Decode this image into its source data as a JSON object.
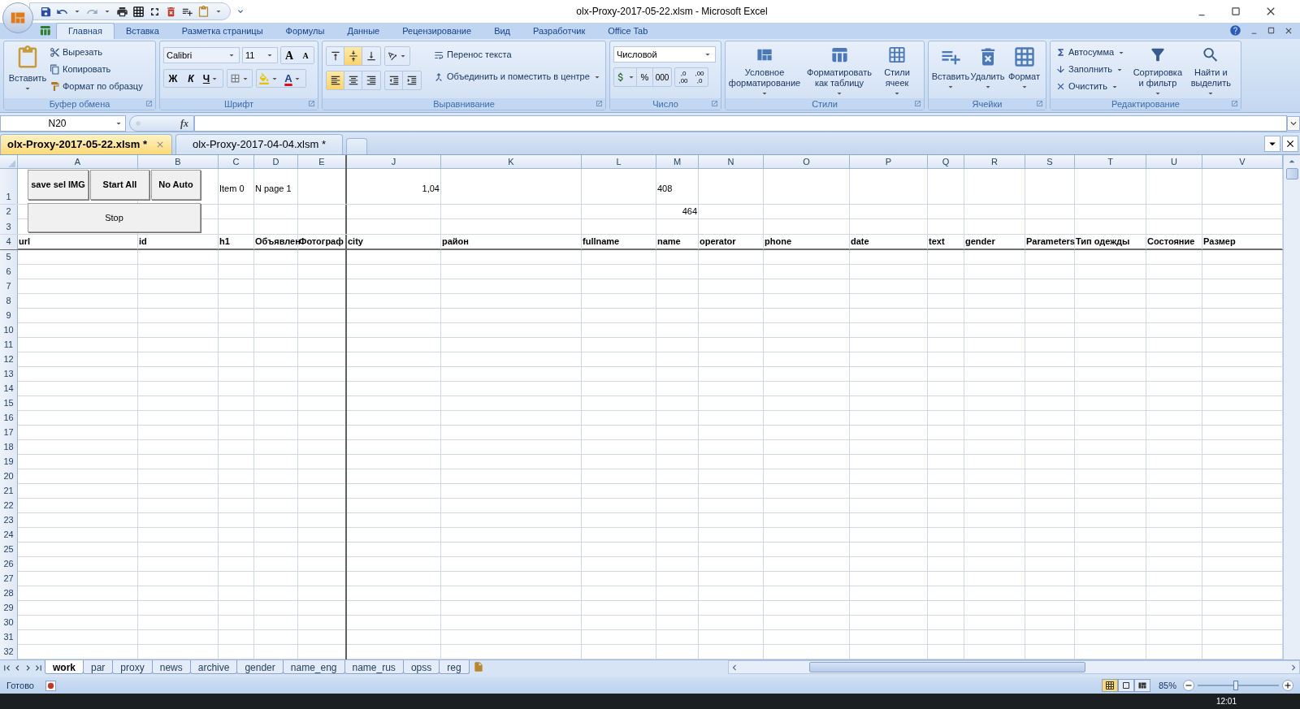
{
  "window": {
    "title": "olx-Proxy-2017-05-22.xlsm - Microsoft Excel"
  },
  "ribbon_tabs": [
    {
      "label": "Главная",
      "selected": true
    },
    {
      "label": "Вставка",
      "selected": false
    },
    {
      "label": "Разметка страницы",
      "selected": false
    },
    {
      "label": "Формулы",
      "selected": false
    },
    {
      "label": "Данные",
      "selected": false
    },
    {
      "label": "Рецензирование",
      "selected": false
    },
    {
      "label": "Вид",
      "selected": false
    },
    {
      "label": "Разработчик",
      "selected": false
    },
    {
      "label": "Office Tab",
      "selected": false
    }
  ],
  "clipboard": {
    "label": "Буфер обмена",
    "paste": "Вставить",
    "cut": "Вырезать",
    "copy": "Копировать",
    "format_painter": "Формат по образцу"
  },
  "font": {
    "label": "Шрифт",
    "name": "Calibri",
    "size": "11",
    "grow": "A",
    "shrink": "A",
    "bold": "Ж",
    "italic": "К",
    "underline": "Ч",
    "font_color": "A"
  },
  "alignment": {
    "label": "Выравнивание",
    "vertical": [
      {
        "selected": false
      },
      {
        "selected": true
      },
      {
        "selected": false
      }
    ],
    "horizontal": [
      {
        "selected": true
      },
      {
        "selected": false
      },
      {
        "selected": false
      }
    ],
    "wrap": "Перенос текста",
    "merge": "Объединить и поместить в центре"
  },
  "number": {
    "label": "Число",
    "format": "Числовой",
    "percent": "%",
    "thousands": "000",
    "decimals": [
      {
        "top": ",0",
        "bottom": ",00"
      },
      {
        "top": ",00",
        "bottom": ",0"
      }
    ]
  },
  "styles": {
    "label": "Стили",
    "buttons": [
      "Условное форматирование",
      "Форматировать как таблицу",
      "Стили ячеек"
    ]
  },
  "cells_group": {
    "label": "Ячейки",
    "buttons": [
      "Вставить",
      "Удалить",
      "Формат"
    ]
  },
  "editing": {
    "label": "Редактирование",
    "small": [
      "Автосумма",
      "Заполнить",
      "Очистить"
    ],
    "large": [
      "Сортировка и фильтр",
      "Найти и выделить"
    ]
  },
  "formula_bar": {
    "name_box": "N20",
    "fx": "fx"
  },
  "doc_tabs": [
    {
      "label": "olx-Proxy-2017-05-22.xlsm *",
      "selected": true
    },
    {
      "label": "olx-Proxy-2017-04-04.xlsm *",
      "selected": false
    }
  ],
  "sheet": {
    "columns": [
      "A",
      "B",
      "C",
      "D",
      "E",
      "J",
      "K",
      "L",
      "M",
      "N",
      "O",
      "P",
      "Q",
      "R",
      "S",
      "T",
      "U",
      "V"
    ],
    "rows": [
      {
        "number": "1",
        "bold": false,
        "cells": {
          "C": {
            "text": "Item 0",
            "right_aligned": false
          },
          "D": {
            "text": "N page 1",
            "right_aligned": false
          },
          "J": {
            "text": "1,04",
            "right_aligned": true
          },
          "M": {
            "text": "408",
            "right_aligned": false
          }
        }
      },
      {
        "number": "2",
        "bold": false,
        "cells": {
          "M": {
            "text": "464",
            "right_aligned": true
          }
        }
      },
      {
        "number": "3"
      },
      {
        "number": "4",
        "bold": true,
        "cells": {
          "A": {
            "text": "url"
          },
          "B": {
            "text": "id"
          },
          "C": {
            "text": "h1"
          },
          "D": {
            "text": "Объявлен"
          },
          "E": {
            "text": "Фотограф"
          },
          "J": {
            "text": "city"
          },
          "K": {
            "text": "район"
          },
          "L": {
            "text": "fullname"
          },
          "M": {
            "text": "name"
          },
          "N": {
            "text": "operator"
          },
          "O": {
            "text": "phone"
          },
          "P": {
            "text": "date"
          },
          "Q": {
            "text": "text"
          },
          "R": {
            "text": "gender"
          },
          "S": {
            "text": "Parameters"
          },
          "T": {
            "text": "Тип одежды"
          },
          "U": {
            "text": "Состояние"
          },
          "V": {
            "text": "Размер"
          }
        }
      },
      {
        "number": "5"
      },
      {
        "number": "6"
      },
      {
        "number": "7"
      },
      {
        "number": "8"
      },
      {
        "number": "9"
      },
      {
        "number": "10"
      },
      {
        "number": "11"
      },
      {
        "number": "12"
      },
      {
        "number": "13"
      },
      {
        "number": "14"
      },
      {
        "number": "15"
      },
      {
        "number": "16"
      },
      {
        "number": "17"
      },
      {
        "number": "18"
      },
      {
        "number": "19"
      },
      {
        "number": "20"
      },
      {
        "number": "21"
      },
      {
        "number": "22"
      },
      {
        "number": "23"
      },
      {
        "number": "24"
      },
      {
        "number": "25"
      },
      {
        "number": "26"
      },
      {
        "number": "27"
      },
      {
        "number": "28"
      },
      {
        "number": "29"
      },
      {
        "number": "30"
      },
      {
        "number": "31"
      },
      {
        "number": "32"
      }
    ]
  },
  "form_buttons": [
    {
      "label": "save sel IMG"
    },
    {
      "label": "Start All"
    },
    {
      "label": "No Auto"
    },
    {
      "label": "Stop"
    }
  ],
  "sheet_tabs": [
    {
      "label": "work",
      "selected": true
    },
    {
      "label": "par",
      "selected": false
    },
    {
      "label": "proxy",
      "selected": false
    },
    {
      "label": "news",
      "selected": false
    },
    {
      "label": "archive",
      "selected": false
    },
    {
      "label": "gender",
      "selected": false
    },
    {
      "label": "name_eng",
      "selected": false
    },
    {
      "label": "name_rus",
      "selected": false
    },
    {
      "label": "opss",
      "selected": false
    },
    {
      "label": "reg",
      "selected": false
    }
  ],
  "status_bar": {
    "status": "Готово",
    "views": [
      {
        "selected": true
      },
      {
        "selected": false
      },
      {
        "selected": false
      }
    ],
    "zoom": "85%",
    "level": 0.47
  },
  "taskbar": {
    "clock": "12:01"
  }
}
